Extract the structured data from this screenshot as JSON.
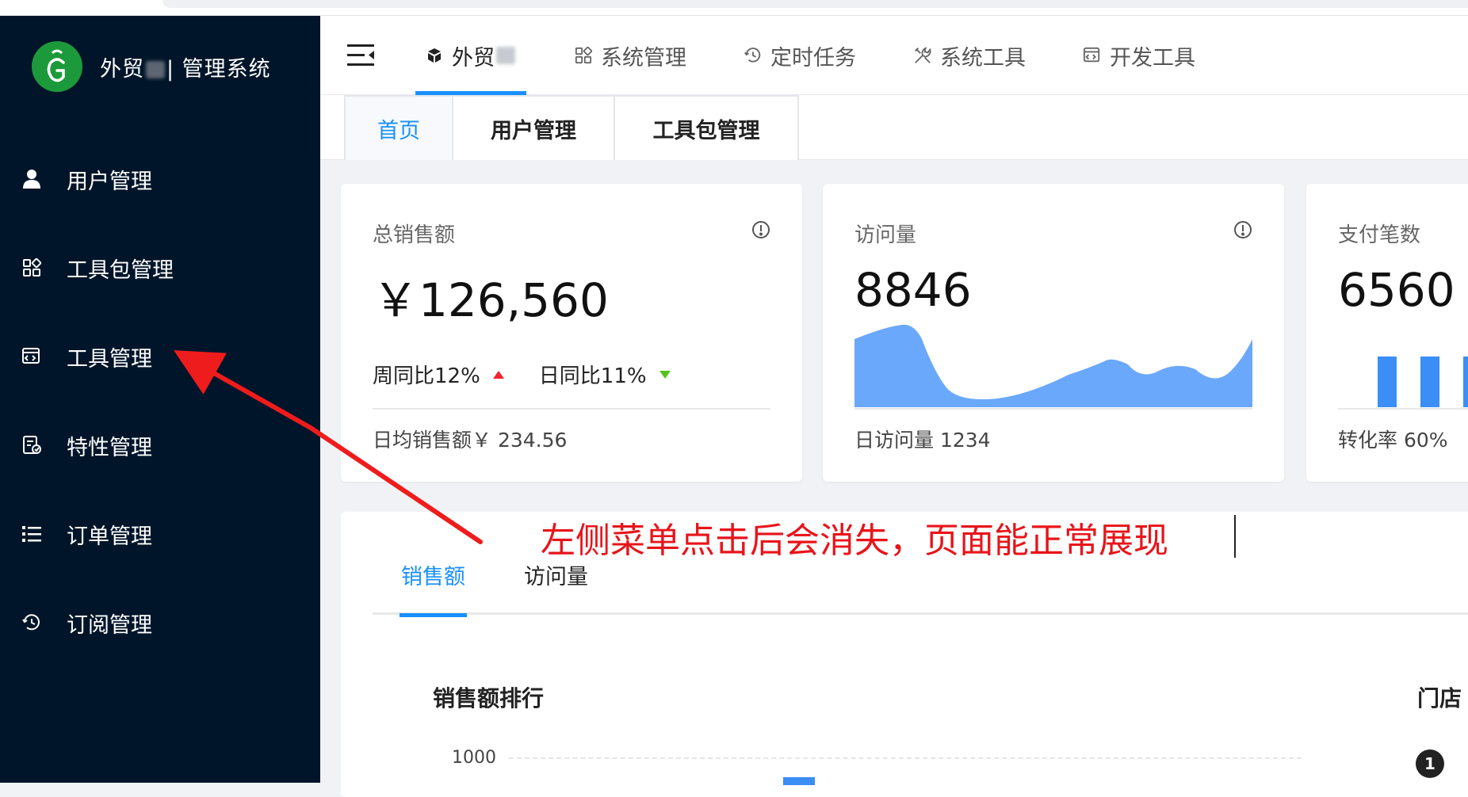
{
  "sidebar": {
    "logo_text_prefix": "外贸",
    "logo_text_suffix": "| 管理系统",
    "items": [
      {
        "label": "用户管理",
        "icon": "user-icon"
      },
      {
        "label": "工具包管理",
        "icon": "apps-grid-icon"
      },
      {
        "label": "工具管理",
        "icon": "code-window-icon"
      },
      {
        "label": "特性管理",
        "icon": "checklist-icon"
      },
      {
        "label": "订单管理",
        "icon": "list-icon"
      },
      {
        "label": "订阅管理",
        "icon": "history-icon"
      }
    ]
  },
  "topnav": {
    "tabs": [
      {
        "label": "外贸",
        "icon": "cube-icon",
        "active": true
      },
      {
        "label": "系统管理",
        "icon": "apps-grid-icon",
        "active": false
      },
      {
        "label": "定时任务",
        "icon": "history-icon",
        "active": false
      },
      {
        "label": "系统工具",
        "icon": "tools-icon",
        "active": false
      },
      {
        "label": "开发工具",
        "icon": "code-window-icon",
        "active": false
      }
    ]
  },
  "pagetabs": [
    {
      "label": "首页",
      "active": true
    },
    {
      "label": "用户管理",
      "active": false
    },
    {
      "label": "工具包管理",
      "active": false
    }
  ],
  "cards": {
    "sales": {
      "title": "总销售额",
      "value": "￥126,560",
      "week_compare": "周同比12%",
      "day_compare": "日同比11%",
      "footer": "日均销售额￥ 234.56"
    },
    "visits": {
      "title": "访问量",
      "value": "8846",
      "footer": "日访问量 1234"
    },
    "payments": {
      "title": "支付笔数",
      "value": "6560",
      "footer": "转化率 60%"
    }
  },
  "panel": {
    "tabs": [
      {
        "label": "销售额",
        "active": true
      },
      {
        "label": "访问量",
        "active": false
      }
    ],
    "rank_title": "销售额排行",
    "store_title": "门店",
    "y_tick": "1000",
    "rank_badge": "1"
  },
  "annotation": {
    "text": "左侧菜单点击后会消失，页面能正常展现",
    "color": "#e8141a"
  },
  "colors": {
    "sidebar_bg": "#001529",
    "accent": "#1890ff",
    "area_fill": "#6aa8fb",
    "bar_fill": "#3a8ef6"
  }
}
